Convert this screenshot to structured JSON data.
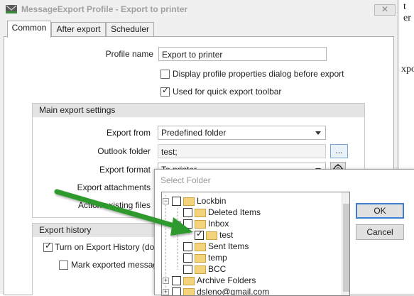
{
  "background": {
    "text_top": "t er",
    "text_mid": "xpor"
  },
  "window": {
    "title": "MessageExport Profile - Export to printer",
    "close_glyph": "✕"
  },
  "tabs": [
    {
      "label": "Common",
      "active": true
    },
    {
      "label": "After export",
      "active": false
    },
    {
      "label": "Scheduler",
      "active": false
    }
  ],
  "profile": {
    "name_label": "Profile name",
    "name_value": "Export to printer",
    "display_dialog_label": "Display profile properties dialog before export",
    "display_dialog_checked": false,
    "quick_toolbar_label": "Used for quick export toolbar",
    "quick_toolbar_checked": true
  },
  "main_settings": {
    "header": "Main export settings",
    "export_from_label": "Export from",
    "export_from_value": "Predefined folder",
    "outlook_folder_label": "Outlook folder",
    "outlook_folder_value": "test;",
    "browse_label": "...",
    "export_format_label": "Export format",
    "export_format_value": "To printer",
    "export_attachments_label": "Export attachments",
    "action_existing_label": "Action existing files"
  },
  "history": {
    "header": "Export history",
    "turn_on_label": "Turn on Export History (do no",
    "turn_on_checked": true,
    "mark_exported_label": "Mark exported messages",
    "mark_exported_checked": false
  },
  "select_folder": {
    "title": "Select Folder",
    "ok_label": "OK",
    "cancel_label": "Cancel",
    "tree": [
      {
        "label": "Lockbin",
        "expander": "−",
        "checked": false,
        "icon": "folder-icon"
      },
      {
        "label": "Deleted Items",
        "expander": "",
        "checked": false,
        "icon": "recycle-folder-icon"
      },
      {
        "label": "Inbox",
        "expander": "−",
        "checked": false,
        "icon": "inbox-icon"
      },
      {
        "label": "test",
        "expander": "",
        "checked": true,
        "icon": "folder-icon"
      },
      {
        "label": "Sent Items",
        "expander": "",
        "checked": false,
        "icon": "sent-folder-icon"
      },
      {
        "label": "temp",
        "expander": "",
        "checked": false,
        "icon": "folder-icon"
      },
      {
        "label": "BCC",
        "expander": "",
        "checked": false,
        "icon": "folder-icon"
      },
      {
        "label": "Archive Folders",
        "expander": "+",
        "checked": false,
        "icon": "folder-icon"
      },
      {
        "label": "dsleno@gmail.com",
        "expander": "+",
        "checked": false,
        "icon": "mailbox-icon"
      }
    ]
  },
  "annotation": {
    "arrow_color": "#2e9a2e"
  }
}
